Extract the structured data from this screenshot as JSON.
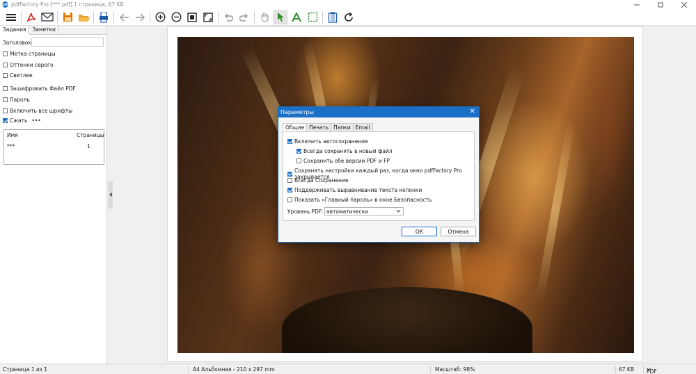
{
  "window": {
    "title": "pdfFactory Pro [***.pdf] 1 страница; 67 KB",
    "icon_letters": "pdf",
    "controls": [
      "minimize-icon",
      "maximize-icon",
      "close-icon"
    ]
  },
  "toolbar": {
    "buttons": [
      "menu-icon",
      "pdf-icon",
      "email-icon",
      "save-icon",
      "open-folder-icon",
      "print-icon",
      "back-arrow-icon",
      "forward-arrow-icon",
      "zoom-in-icon",
      "zoom-out-icon",
      "fit-page-icon",
      "fullscreen-icon",
      "undo-icon",
      "redo-icon",
      "hand-tool-icon",
      "select-arrow-icon",
      "text-tool-icon",
      "crop-tool-icon",
      "notes-icon",
      "refresh-icon"
    ],
    "selected": "select-arrow-icon",
    "accent_green": "#2e8b2e",
    "accent_orange": "#e07b00",
    "accent_red": "#d42020"
  },
  "left_panel": {
    "tabs": [
      "Задания",
      "Заметки"
    ],
    "active_tab": "Задания",
    "title_label": "Заголовок:",
    "options": [
      {
        "label": "Метка страницы",
        "checked": false
      },
      {
        "label": "Оттенки серого",
        "checked": false
      },
      {
        "label": "Светлее",
        "checked": false
      },
      {
        "label": "Зашифровать Файл PDF",
        "checked": false
      },
      {
        "label": "Пароль",
        "checked": false
      },
      {
        "label": "Включить все шрифты",
        "checked": false
      },
      {
        "label": "Сжать",
        "checked": true
      }
    ],
    "compress_more": "•••",
    "jobs": {
      "col_name": "Имя",
      "col_pages": "Страницы",
      "rows": [
        {
          "name": "***",
          "pages": "1"
        }
      ]
    }
  },
  "dialog": {
    "title": "Параметры",
    "tabs": [
      "Общие",
      "Печать",
      "Папки",
      "Email"
    ],
    "active_tab": "Общие",
    "options": [
      {
        "label": "Включить автосохранение",
        "checked": true
      },
      {
        "label": "Всегда сохранять в новый файл",
        "checked": true
      },
      {
        "label": "Сохранить обе версии PDF и FP",
        "checked": false
      },
      {
        "label": "Сохранять настройки каждый раз, когда окно pdfFactory Pro закрывается",
        "checked": true
      },
      {
        "label": "Всегда Сохранение",
        "checked": false
      },
      {
        "label": "Поддерживать выравнивание текста колонки",
        "checked": true
      },
      {
        "label": "Показать «Главный пароль» в окне Безопасность",
        "checked": false
      }
    ],
    "pdf_level_label": "Уровень PDF:",
    "pdf_level_value": "автоматически",
    "ok_label": "ОК",
    "cancel_label": "Отмена",
    "accent": "#1a6fc7"
  },
  "status": {
    "page": "Страница 1 из 1",
    "paper": "A4 Альбомная - 210 x 297 mm",
    "zoom": "Масштаб: 98%",
    "size": "67 KB",
    "pdf_version": "PDF 1.4"
  }
}
